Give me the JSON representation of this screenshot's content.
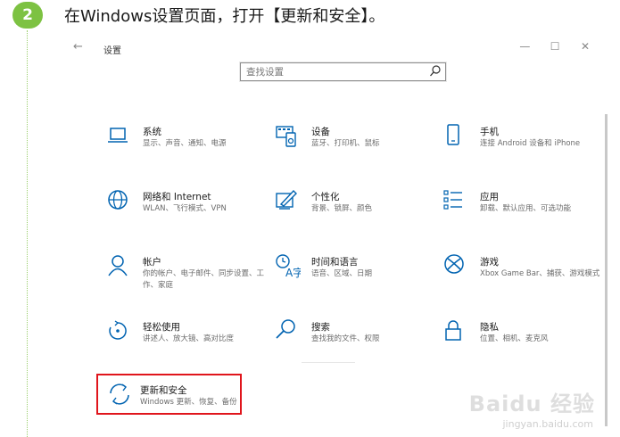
{
  "step": {
    "number": "2",
    "text": "在Windows设置页面，打开【更新和安全】。"
  },
  "window": {
    "title": "设置",
    "back": "←",
    "controls": {
      "minimize": "—",
      "maximize": "☐",
      "close": "✕"
    }
  },
  "search": {
    "placeholder": "查找设置"
  },
  "tiles": [
    {
      "title": "系统",
      "desc": "显示、声音、通知、电源",
      "icon": "laptop-icon"
    },
    {
      "title": "设备",
      "desc": "蓝牙、打印机、鼠标",
      "icon": "devices-icon"
    },
    {
      "title": "手机",
      "desc": "连接 Android 设备和 iPhone",
      "icon": "phone-icon"
    },
    {
      "title": "网络和 Internet",
      "desc": "WLAN、飞行模式、VPN",
      "icon": "globe-icon"
    },
    {
      "title": "个性化",
      "desc": "背景、锁屏、颜色",
      "icon": "personalization-icon"
    },
    {
      "title": "应用",
      "desc": "卸载、默认应用、可选功能",
      "icon": "apps-icon"
    },
    {
      "title": "帐户",
      "desc": "你的帐户、电子邮件、同步设置、工作、家庭",
      "icon": "person-icon"
    },
    {
      "title": "时间和语言",
      "desc": "语音、区域、日期",
      "icon": "time-language-icon"
    },
    {
      "title": "游戏",
      "desc": "Xbox Game Bar、捕获、游戏模式",
      "icon": "xbox-icon"
    },
    {
      "title": "轻松使用",
      "desc": "讲述人、放大镜、高对比度",
      "icon": "ease-of-access-icon"
    },
    {
      "title": "搜索",
      "desc": "查找我的文件、权限",
      "icon": "search-icon"
    },
    {
      "title": "隐私",
      "desc": "位置、相机、麦克风",
      "icon": "lock-icon"
    },
    {
      "title": "更新和安全",
      "desc": "Windows 更新、恢复、备份",
      "icon": "update-icon"
    }
  ],
  "colors": {
    "accent": "#0063b1",
    "highlight": "#e0151c",
    "badge": "#7dc242"
  },
  "watermark": {
    "text": "Baidu 经验",
    "sub": "jingyan.baidu.com"
  }
}
